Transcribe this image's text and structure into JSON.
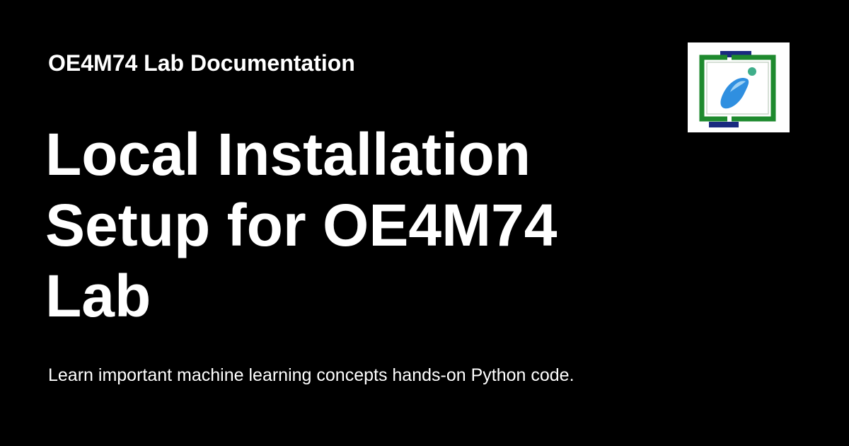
{
  "social_card": {
    "site_name": "OE4M74 Lab Documentation",
    "title": "Local Installation Setup for OE4M74 Lab",
    "description": "Learn important machine learning concepts hands-on Python code.",
    "logo_icon": "lab-logo-icon",
    "colors": {
      "background": "#000000",
      "text": "#ffffff",
      "logo_background": "#ffffff",
      "logo_frame_green": "#1e8a2e",
      "logo_frame_navy": "#1a2a80",
      "logo_drop_blue": "#2f8fe0",
      "logo_accent_teal": "#3fae8a"
    }
  }
}
